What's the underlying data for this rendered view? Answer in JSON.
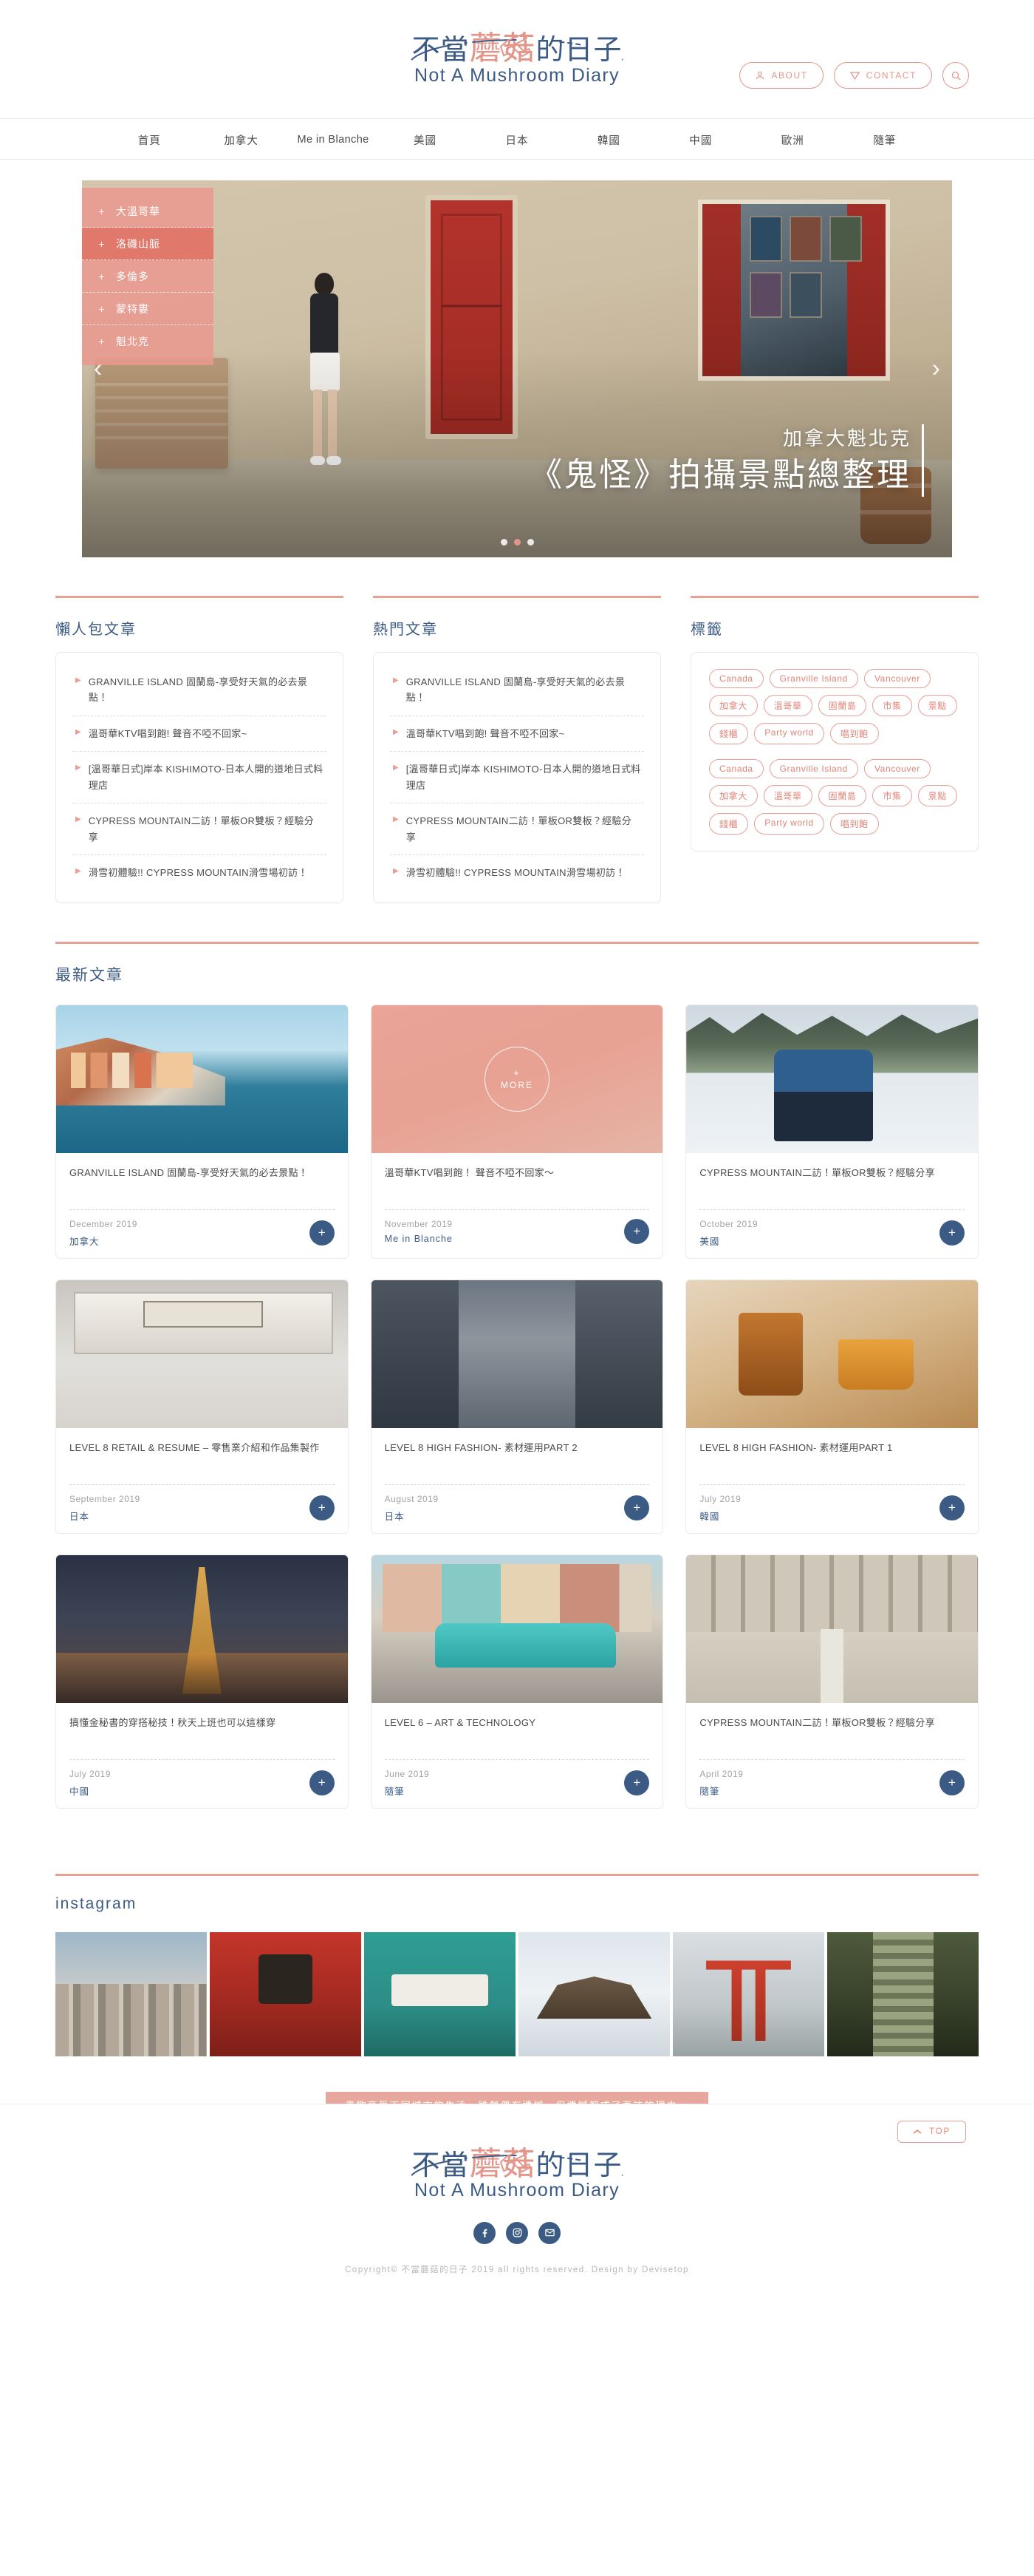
{
  "site": {
    "logo_cn_1": "不當",
    "logo_cn_pink": "蘑菇",
    "logo_cn_2": "的日子",
    "logo_en": "Not A Mushroom Diary"
  },
  "header": {
    "about_label": "ABOUT",
    "contact_label": "CONTACT",
    "search_label": "search"
  },
  "nav": {
    "items": [
      {
        "label": "首頁"
      },
      {
        "label": "加拿大"
      },
      {
        "label": "Me in Blanche"
      },
      {
        "label": "美國"
      },
      {
        "label": "日本"
      },
      {
        "label": "韓國"
      },
      {
        "label": "中國"
      },
      {
        "label": "歐洲"
      },
      {
        "label": "隨筆"
      }
    ]
  },
  "hero": {
    "menu": [
      {
        "label": "大溫哥華",
        "active": false
      },
      {
        "label": "洛磯山脈",
        "active": true
      },
      {
        "label": "多倫多",
        "active": false
      },
      {
        "label": "蒙特婁",
        "active": false
      },
      {
        "label": "魁北克",
        "active": false
      }
    ],
    "subtitle": "加拿大魁北克",
    "title": "《鬼怪》拍攝景點總整理",
    "prev_arrow": "‹",
    "next_arrow": "›",
    "dots": [
      {
        "active": false
      },
      {
        "active": true
      },
      {
        "active": false
      }
    ]
  },
  "columns": {
    "lazy": {
      "title": "懶人包文章",
      "items": [
        "GRANVILLE ISLAND 固蘭島-享受好天氣的必去景點！",
        "溫哥華KTV唱到飽! 聲音不啞不回家~",
        "[溫哥華日式]岸本 KISHIMOTO-日本人開的道地日式料理店",
        "CYPRESS MOUNTAIN二訪！單板OR雙板？經驗分享",
        "滑雪初體驗!! CYPRESS MOUNTAIN滑雪場初訪！"
      ]
    },
    "popular": {
      "title": "熱門文章",
      "items": [
        "GRANVILLE ISLAND 固蘭島-享受好天氣的必去景點！",
        "溫哥華KTV唱到飽! 聲音不啞不回家~",
        "[溫哥華日式]岸本 KISHIMOTO-日本人開的道地日式料理店",
        "CYPRESS MOUNTAIN二訪！單板OR雙板？經驗分享",
        "滑雪初體驗!! CYPRESS MOUNTAIN滑雪場初訪！"
      ]
    },
    "tags": {
      "title": "標籤",
      "group_one": [
        "Canada",
        "Granville Island",
        "Vancouver",
        "加拿大",
        "溫哥華",
        "固蘭島",
        "市集",
        "景點",
        "錢櫃",
        "Party world",
        "唱到飽"
      ],
      "group_two": [
        "Canada",
        "Granville Island",
        "Vancouver",
        "加拿大",
        "溫哥華",
        "固蘭島",
        "市集",
        "景點",
        "錢櫃",
        "Party world",
        "唱到飽"
      ]
    }
  },
  "latest": {
    "title": "最新文章",
    "plus_label": "+",
    "cards": [
      {
        "title": "GRANVILLE ISLAND 固蘭島-享受好天氣的必去景點！",
        "date": "December 2019",
        "category": "加拿大",
        "img": "im-cinque"
      },
      {
        "title": "溫哥華KTV唱到飽！ 聲音不啞不回家～",
        "date": "November 2019",
        "category": "Me in Blanche",
        "img": "im-more",
        "overlay_more": "MORE"
      },
      {
        "title": "CYPRESS MOUNTAIN二訪！單板OR雙板？經驗分享",
        "date": "October 2019",
        "category": "美國",
        "img": "im-ski"
      },
      {
        "title": "LEVEL 8 RETAIL & RESUME – 零售業介紹和作品集製作",
        "date": "September 2019",
        "category": "日本",
        "img": "im-store"
      },
      {
        "title": "LEVEL 8 HIGH FASHION- 素材運用PART 2",
        "date": "August 2019",
        "category": "日本",
        "img": "im-street"
      },
      {
        "title": "LEVEL 8 HIGH FASHION- 素材運用PART 1",
        "date": "July 2019",
        "category": "韓國",
        "img": "im-coffee"
      },
      {
        "title": "搞懂金秘書的穿搭秘技！秋天上班也可以這樣穿",
        "date": "July 2019",
        "category": "中國",
        "img": "im-paris"
      },
      {
        "title": "LEVEL 6 – ART & TECHNOLOGY",
        "date": "June 2019",
        "category": "隨筆",
        "img": "im-car"
      },
      {
        "title": "CYPRESS MOUNTAIN二訪！單板OR雙板？經驗分享",
        "date": "April 2019",
        "category": "隨筆",
        "img": "im-court"
      }
    ]
  },
  "instagram": {
    "title": "instagram",
    "cells": [
      "ig1",
      "ig2",
      "ig3",
      "ig4",
      "ig5",
      "ig6"
    ]
  },
  "footer": {
    "quote": "喜歡享受不同城市的生活，雖然偶有遺憾，但遺憾都成了再訪的理由。",
    "top_label": "TOP",
    "copyright": "Copyright© 不當蘑菇的日子 2019 all rights reserved.  Design by Devisetop"
  },
  "colors": {
    "brand_blue": "#3b5b84",
    "brand_pink": "#e4958a",
    "accent_line": "#e8a095",
    "quote_bg": "#e8a79c"
  }
}
